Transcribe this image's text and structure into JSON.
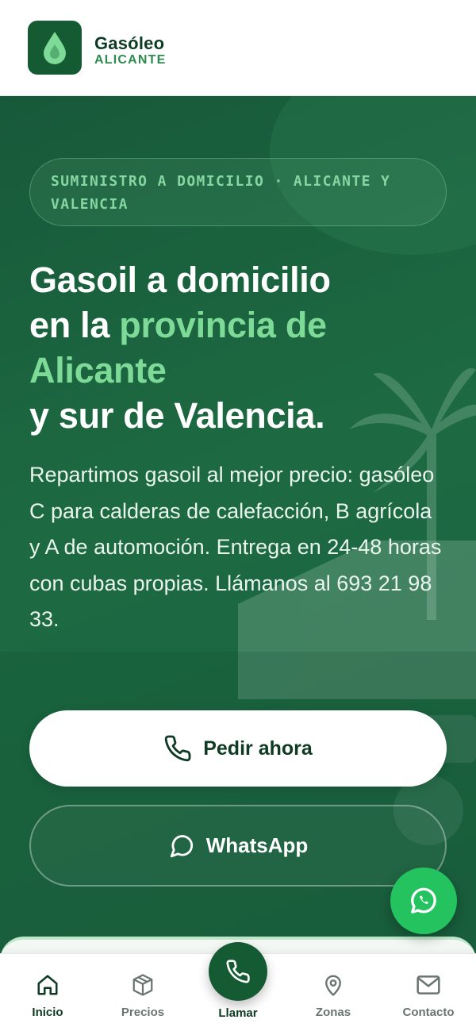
{
  "header": {
    "brand_name": "Gasóleo",
    "brand_sub": "ALICANTE",
    "logo_icon": "drop-icon"
  },
  "hero": {
    "badge_line1": "SUMINISTRO A DOMICILIO · ALICANTE Y",
    "badge_line2": "VALENCIA",
    "headline_part1": "Gasoil a domicilio",
    "headline_part2": "en la ",
    "headline_accent1": "provincia de",
    "headline_accent2": "Alicante",
    "headline_part3": "y sur de Valencia.",
    "description": "Repartimos gasoil al mejor precio: gasóleo C para calderas de calefacción, B agrícola y A de automoción. Entrega en 24-48 horas con cubas propias. Llámanos al 693 21 98 33.",
    "primary_button": "Pedir ahora",
    "secondary_button": "WhatsApp"
  },
  "bottom_nav": {
    "items": [
      {
        "label": "Inicio",
        "icon": "home-icon",
        "active": true
      },
      {
        "label": "Precios",
        "icon": "box-icon",
        "active": false
      },
      {
        "label": "Llamar",
        "icon": "phone-icon",
        "active": false
      },
      {
        "label": "Zonas",
        "icon": "map-pin-icon",
        "active": false
      },
      {
        "label": "Contacto",
        "icon": "mail-icon",
        "active": false
      }
    ]
  },
  "colors": {
    "brand_dark": "#145a32",
    "accent_green": "#7ddb97",
    "whatsapp_green": "#25c360",
    "text_dark": "#0f3b24"
  }
}
